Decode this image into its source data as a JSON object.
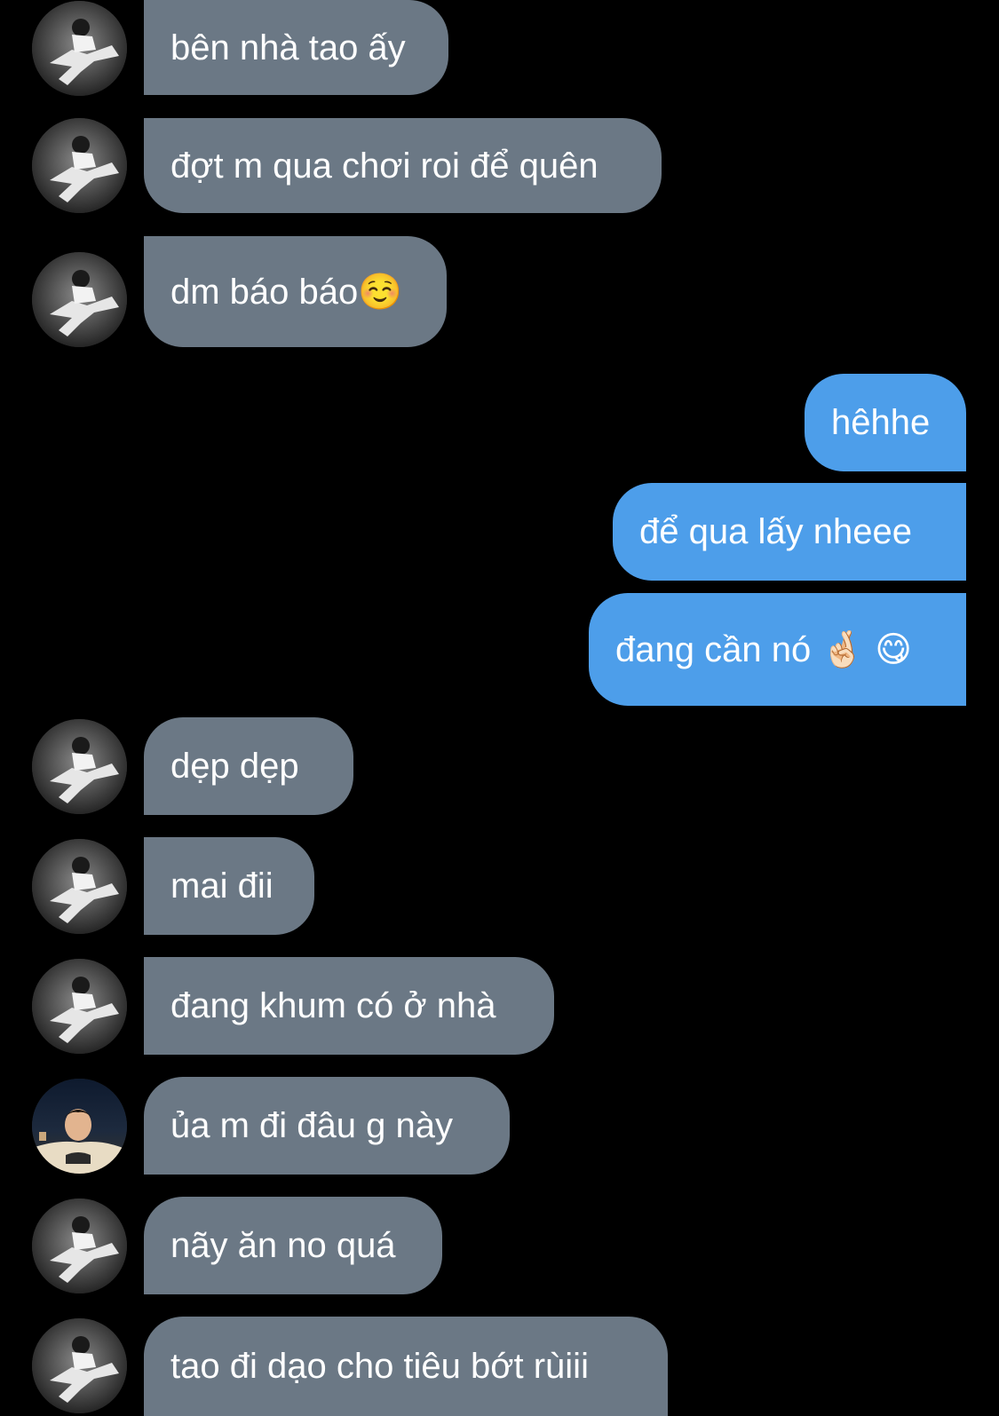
{
  "conversation": {
    "messages": [
      {
        "direction": "in",
        "text": "bên nhà tao ấy",
        "avatar": "avatar-bw-icon"
      },
      {
        "direction": "in",
        "text": "đợt m qua chơi roi để quên",
        "avatar": "avatar-bw-icon"
      },
      {
        "direction": "in",
        "text": "dm báo báo☺️",
        "avatar": "avatar-bw-icon"
      },
      {
        "direction": "out",
        "text": "hêhhe"
      },
      {
        "direction": "out",
        "text": "để qua lấy nheee"
      },
      {
        "direction": "out",
        "text": "đang cần nó 🤞🏻 😋"
      },
      {
        "direction": "in",
        "text": "dẹp dẹp ",
        "avatar": "avatar-bw-icon"
      },
      {
        "direction": "in",
        "text": "mai đii",
        "avatar": "avatar-bw-icon"
      },
      {
        "direction": "in",
        "text": "đang khum có ở nhà",
        "avatar": "avatar-bw-icon"
      },
      {
        "direction": "in",
        "text": "ủa m đi đâu g này",
        "avatar": "avatar-color-icon"
      },
      {
        "direction": "in",
        "text": "nãy ăn no quá",
        "avatar": "avatar-bw-icon"
      },
      {
        "direction": "in",
        "text": "tao đi dạo cho tiêu bớt rùiii",
        "avatar": "avatar-bw-icon"
      }
    ]
  },
  "colors": {
    "background": "#000000",
    "incoming_bubble": "#6b7885",
    "outgoing_bubble": "#4d9eea",
    "text": "#ffffff"
  }
}
